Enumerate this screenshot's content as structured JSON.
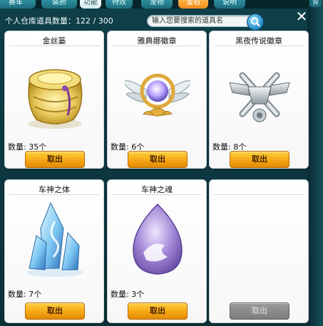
{
  "tabs": [
    {
      "label": "赛车"
    },
    {
      "label": "装扮"
    },
    {
      "label": "功能"
    },
    {
      "label": "特效"
    },
    {
      "label": "宠物"
    },
    {
      "label": "宝石"
    },
    {
      "label": "说明"
    }
  ],
  "side_tab": {
    "label": "背"
  },
  "header": {
    "count_text": "个人仓库道具数量：122 / 300",
    "search_placeholder": "输入您要搜索的道具名",
    "close": "✕"
  },
  "items": [
    {
      "name": "金丝篓",
      "qty": "数量: 35个",
      "action": "取出"
    },
    {
      "name": "雅典娜徽章",
      "qty": "数量: 6个",
      "action": "取出"
    },
    {
      "name": "黑夜传说徽章",
      "qty": "数量: 8个",
      "action": "取出"
    },
    {
      "name": "车神之体",
      "qty": "数量: 7个",
      "action": "取出"
    },
    {
      "name": "车神之魂",
      "qty": "数量: 3个",
      "action": "取出"
    },
    {
      "name": "",
      "qty": "",
      "action": "取出"
    }
  ],
  "colors": {
    "accent_button": "#f5a412",
    "background": "#0f3f49"
  }
}
